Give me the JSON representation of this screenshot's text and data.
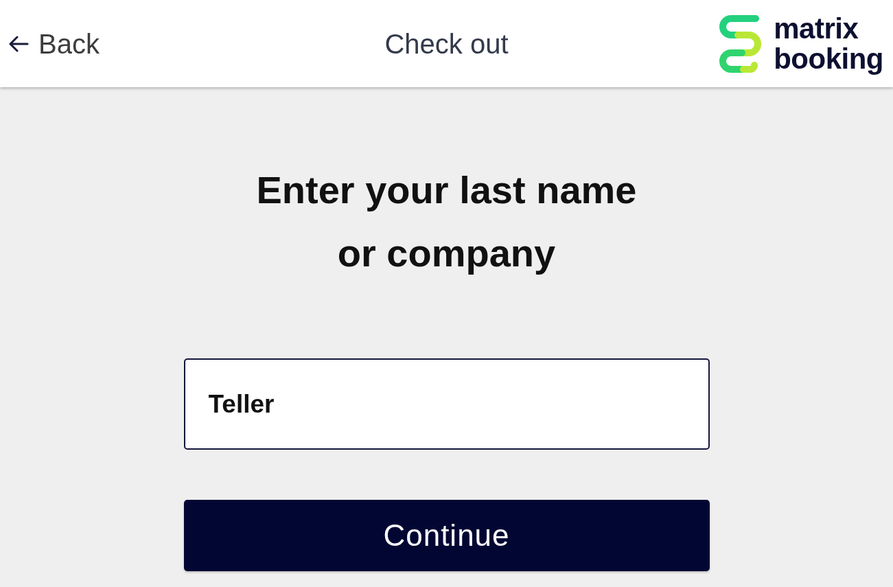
{
  "header": {
    "back_label": "Back",
    "title": "Check out",
    "logo_text": [
      "matrix",
      "booking"
    ]
  },
  "heading": "Enter your last name or company",
  "name_field": {
    "value": "Teller"
  },
  "continue_button": {
    "label": "Continue"
  }
}
